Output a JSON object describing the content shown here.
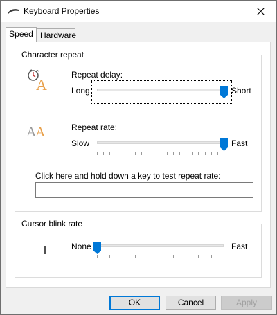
{
  "window": {
    "title": "Keyboard Properties",
    "close_glyph": "✕"
  },
  "tabs": [
    {
      "label": "Speed",
      "active": true
    },
    {
      "label": "Hardware",
      "active": false
    }
  ],
  "character_repeat": {
    "group_label": "Character repeat",
    "repeat_delay": {
      "label": "Repeat delay:",
      "min_label": "Long",
      "max_label": "Short",
      "value_fraction": 1.0
    },
    "repeat_rate": {
      "label": "Repeat rate:",
      "min_label": "Slow",
      "max_label": "Fast",
      "value_fraction": 1.0
    },
    "test_prompt": "Click here and hold down a key to test repeat rate:",
    "test_value": ""
  },
  "cursor_blink": {
    "group_label": "Cursor blink rate",
    "min_label": "None",
    "max_label": "Fast",
    "value_fraction": 0.0
  },
  "buttons": {
    "ok": "OK",
    "cancel": "Cancel",
    "apply": "Apply"
  },
  "colors": {
    "accent": "#0078d7",
    "icon_orange": "#e8a04a",
    "icon_gray": "#9a9a9a"
  }
}
